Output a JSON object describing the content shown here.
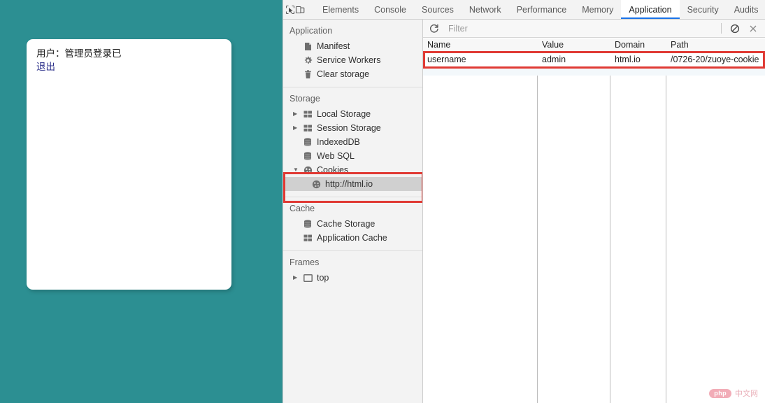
{
  "page": {
    "background_color": "#2c8f92",
    "card": {
      "user_line": "用户：管理员登录已",
      "logout_label": "退出",
      "logout_color": "#2b2f8a"
    }
  },
  "devtools": {
    "toolbar": {
      "inspect_icon": "inspect-cursor-icon",
      "device_icon": "device-toolbar-icon"
    },
    "tabs": [
      {
        "label": "Elements",
        "active": false
      },
      {
        "label": "Console",
        "active": false
      },
      {
        "label": "Sources",
        "active": false
      },
      {
        "label": "Network",
        "active": false
      },
      {
        "label": "Performance",
        "active": false
      },
      {
        "label": "Memory",
        "active": false
      },
      {
        "label": "Application",
        "active": true
      },
      {
        "label": "Security",
        "active": false
      },
      {
        "label": "Audits",
        "active": false
      }
    ],
    "active_tab": "Application",
    "active_tab_underline_color": "#1a73e8",
    "sidebar": {
      "sections": [
        {
          "title": "Application",
          "items": [
            {
              "label": "Manifest",
              "icon": "document-icon",
              "twisty": "",
              "selected": false,
              "indent": false
            },
            {
              "label": "Service Workers",
              "icon": "gear-icon",
              "twisty": "",
              "selected": false,
              "indent": false
            },
            {
              "label": "Clear storage",
              "icon": "trash-icon",
              "twisty": "",
              "selected": false,
              "indent": false
            }
          ]
        },
        {
          "title": "Storage",
          "items": [
            {
              "label": "Local Storage",
              "icon": "table-icon",
              "twisty": "▶",
              "selected": false,
              "indent": false
            },
            {
              "label": "Session Storage",
              "icon": "table-icon",
              "twisty": "▶",
              "selected": false,
              "indent": false
            },
            {
              "label": "IndexedDB",
              "icon": "database-icon",
              "twisty": "",
              "selected": false,
              "indent": false
            },
            {
              "label": "Web SQL",
              "icon": "database-icon",
              "twisty": "",
              "selected": false,
              "indent": false
            },
            {
              "label": "Cookies",
              "icon": "cookie-icon",
              "twisty": "▼",
              "selected": false,
              "indent": false
            },
            {
              "label": "http://html.io",
              "icon": "cookie-icon",
              "twisty": "",
              "selected": true,
              "indent": true
            }
          ]
        },
        {
          "title": "Cache",
          "items": [
            {
              "label": "Cache Storage",
              "icon": "database-icon",
              "twisty": "",
              "selected": false,
              "indent": false
            },
            {
              "label": "Application Cache",
              "icon": "table-icon",
              "twisty": "",
              "selected": false,
              "indent": false
            }
          ]
        },
        {
          "title": "Frames",
          "items": [
            {
              "label": "top",
              "icon": "frame-icon",
              "twisty": "▶",
              "selected": false,
              "indent": false
            }
          ]
        }
      ]
    },
    "filter_bar": {
      "refresh_icon": "refresh-icon",
      "placeholder": "Filter",
      "value": "",
      "clear_icon": "block-clear-icon",
      "close_icon": "close-icon"
    },
    "cookie_table": {
      "columns": [
        "Name",
        "Value",
        "Domain",
        "Path"
      ],
      "rows": [
        {
          "Name": "username",
          "Value": "admin",
          "Domain": "html.io",
          "Path": "/0726-20/zuoye-cookie"
        }
      ]
    },
    "annotations": {
      "color": "#e03a34",
      "regions": [
        "cookie-table-row",
        "cookies-sidebar-node"
      ]
    }
  },
  "watermark": {
    "badge": "php",
    "text": "中文网"
  }
}
